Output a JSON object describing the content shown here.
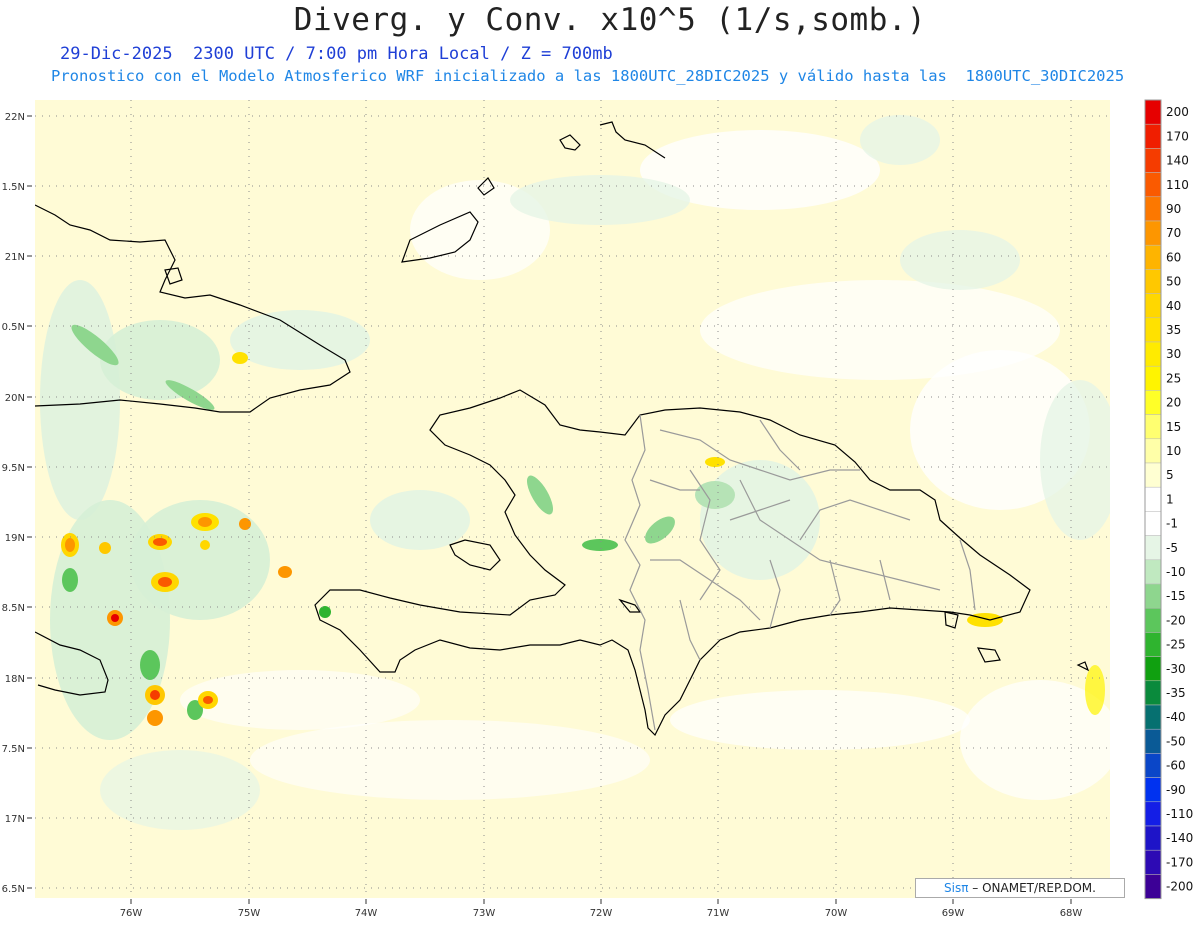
{
  "header": {
    "title": "Diverg. y Conv. x10^5 (1/s,somb.)",
    "subtitle_line1": "29-Dic-2025  2300 UTC / 7:00 pm Hora Local / Z = 700mb",
    "subtitle_line2": "Pronostico con el Modelo Atmosferico WRF inicializado a las 1800UTC_28DIC2025 y válido hasta las  1800UTC_30DIC2025"
  },
  "map": {
    "lat_labels": [
      "22N",
      "1.5N",
      "21N",
      "0.5N",
      "20N",
      "9.5N",
      "19N",
      "8.5N",
      "18N",
      "7.5N",
      "17N",
      "6.5N"
    ],
    "lon_labels": [
      "76W",
      "75W",
      "74W",
      "73W",
      "72W",
      "71W",
      "70W",
      "69W",
      "68W"
    ],
    "colors": {
      "background_weak": "#fffbd0",
      "coast": "#000000",
      "provinces": "#a0a0a0",
      "grid": "#888888"
    }
  },
  "colorbar": {
    "levels": [
      "200",
      "170",
      "140",
      "110",
      "90",
      "70",
      "60",
      "50",
      "40",
      "35",
      "30",
      "25",
      "20",
      "15",
      "10",
      "5",
      "1",
      "-1",
      "-5",
      "-10",
      "-15",
      "-20",
      "-25",
      "-30",
      "-35",
      "-40",
      "-50",
      "-60",
      "-90",
      "-110",
      "-140",
      "-170",
      "-200"
    ],
    "colors": [
      "#e60000",
      "#f01e00",
      "#f53c00",
      "#fa5a00",
      "#fc7800",
      "#fd9600",
      "#feb400",
      "#ffc800",
      "#ffd700",
      "#ffe100",
      "#ffeb00",
      "#fff400",
      "#ffff28",
      "#ffff70",
      "#ffffa8",
      "#ffffd2",
      "#ffffff",
      "#ffffff",
      "#e6f5e6",
      "#c0e9c0",
      "#8ed68e",
      "#5cc65c",
      "#2fb42f",
      "#10a010",
      "#0a8a3c",
      "#067070",
      "#0a5a96",
      "#0a46c8",
      "#0032f0",
      "#141ee6",
      "#1e14c8",
      "#2d0ab4",
      "#3c0096"
    ]
  },
  "credit": {
    "brand": "Sisπ",
    "text": "– ONAMET/REP.DOM."
  }
}
